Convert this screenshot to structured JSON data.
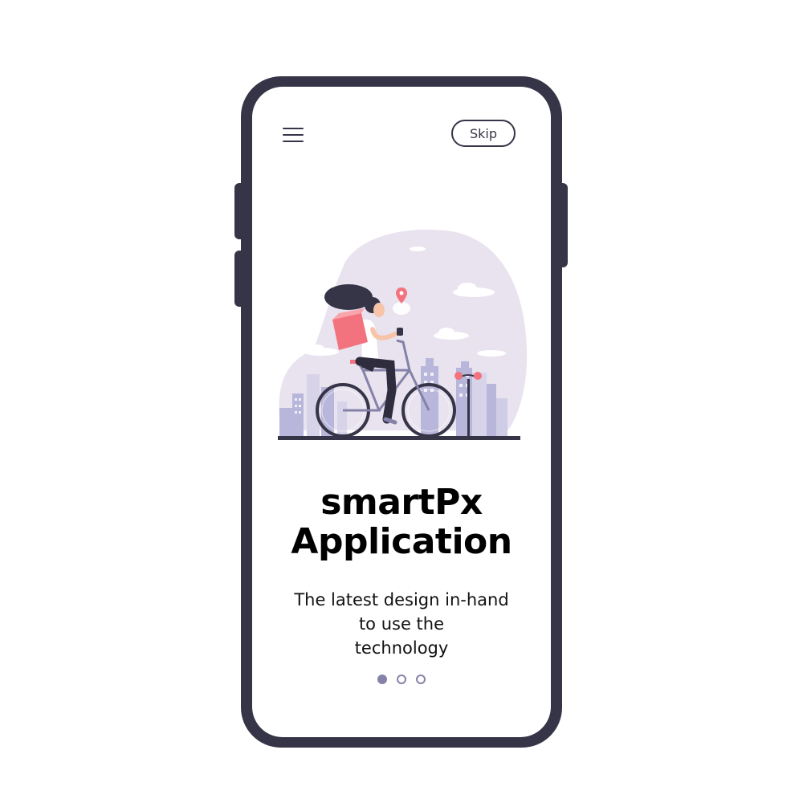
{
  "header": {
    "skip_label": "Skip"
  },
  "content": {
    "title_line1": "smartPx",
    "title_line2": "Application",
    "subtitle_line1": "The latest design in-hand",
    "subtitle_line2": "to use the",
    "subtitle_line3": "technology"
  },
  "pager": {
    "total": 3,
    "active_index": 0
  },
  "icons": {
    "menu": "hamburger-menu-icon",
    "pin": "location-pin-icon"
  },
  "colors": {
    "phone_frame": "#363447",
    "accent": "#8482a8",
    "blob": "#e8e2ee",
    "box": "#f2737e",
    "buildings": "#b8b6da"
  }
}
